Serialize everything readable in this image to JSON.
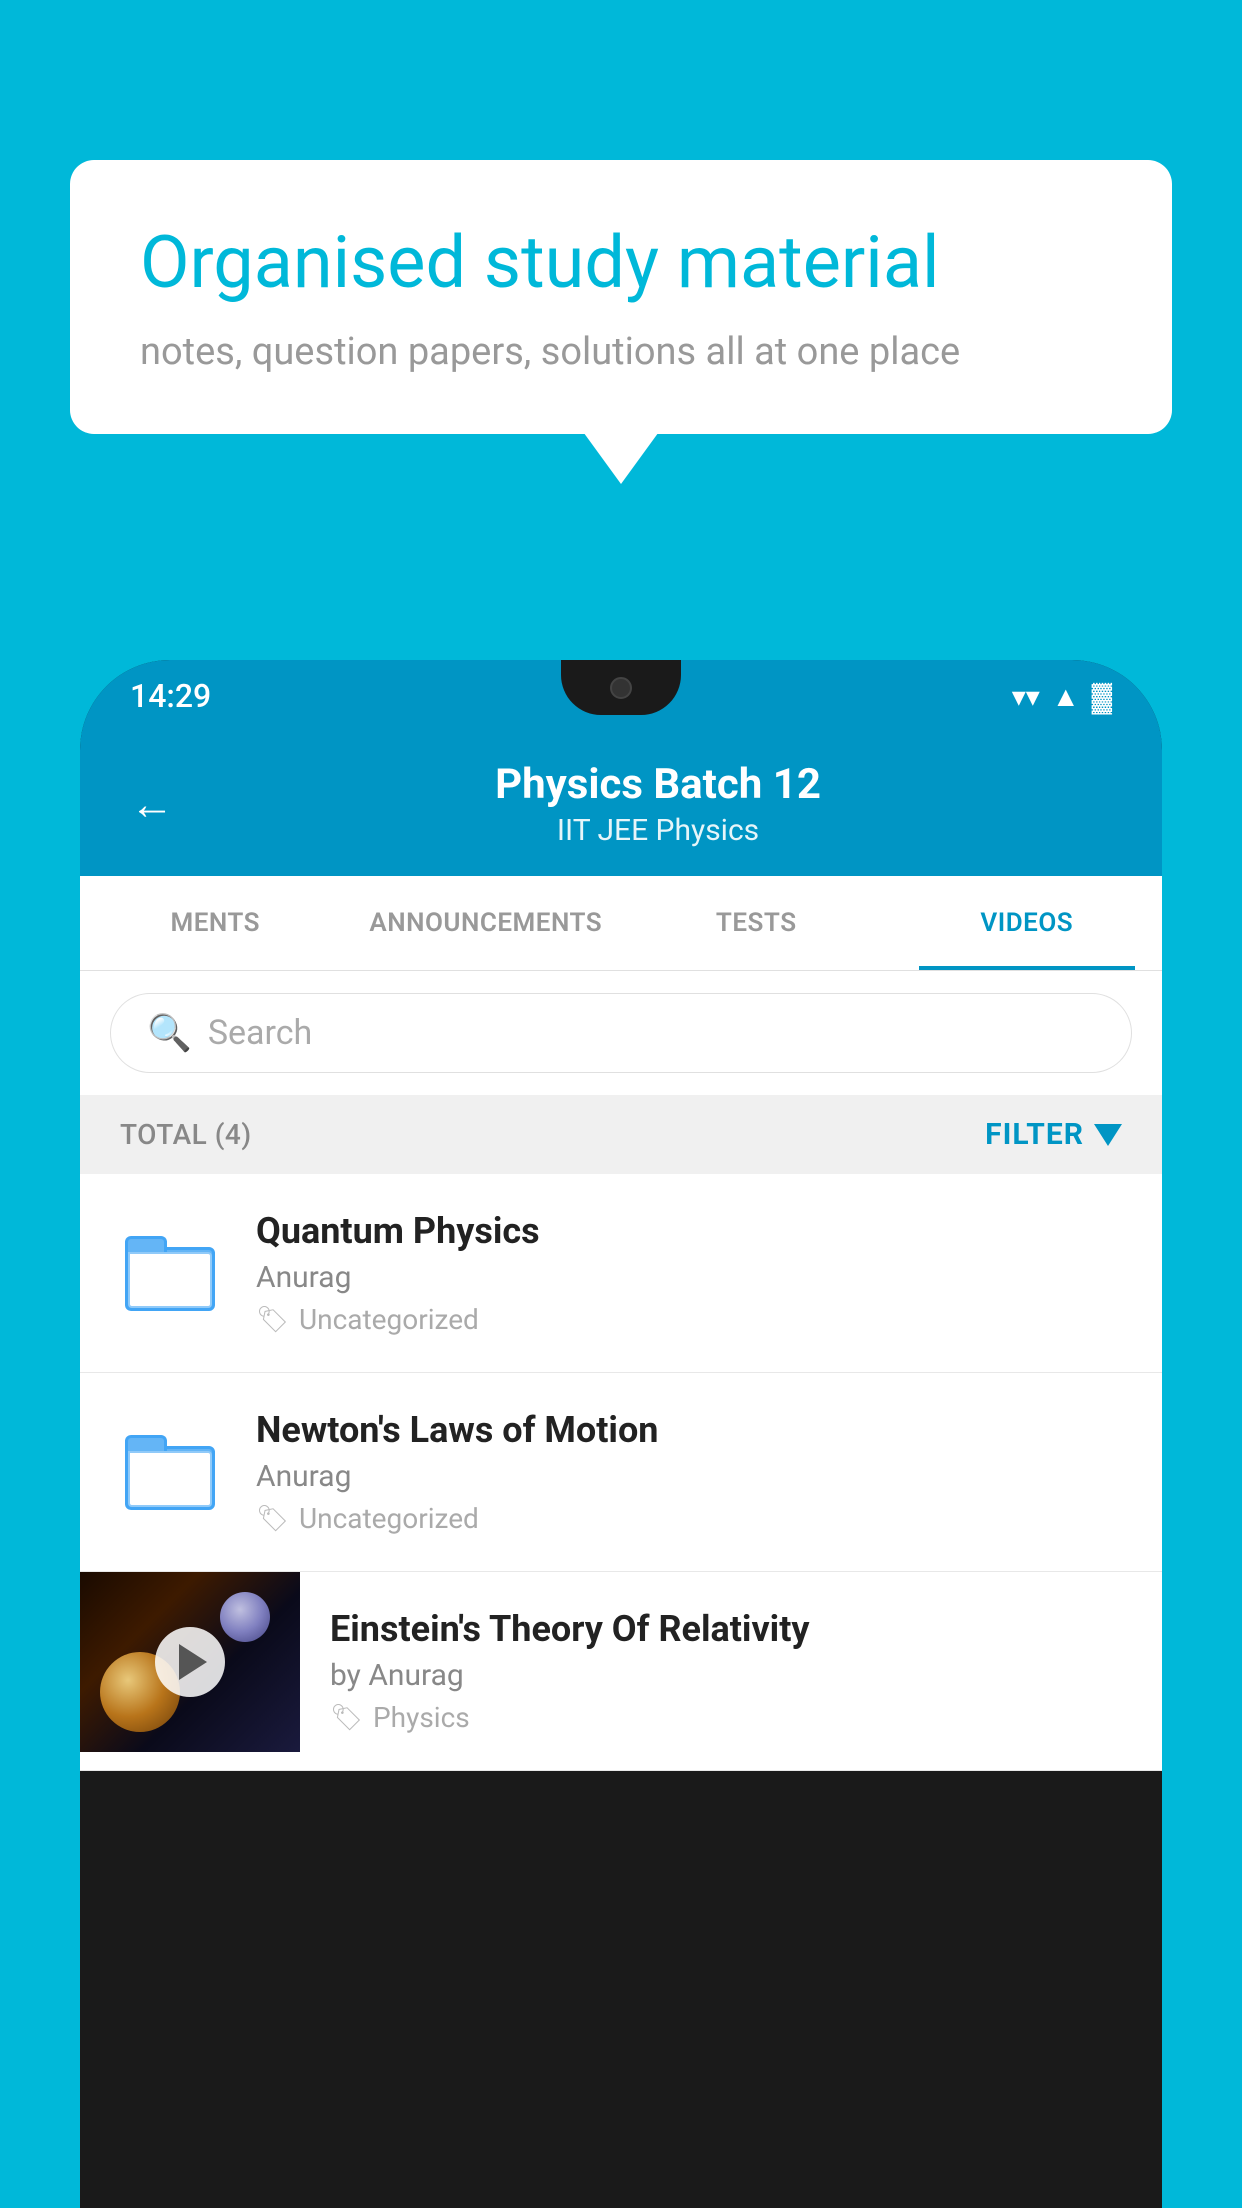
{
  "background_color": "#00B8D9",
  "speech_bubble": {
    "headline": "Organised study material",
    "subtext": "notes, question papers, solutions all at one place"
  },
  "status_bar": {
    "time": "14:29",
    "wifi": "▼",
    "signal": "▲",
    "battery": "▓"
  },
  "app_header": {
    "back_label": "←",
    "title": "Physics Batch 12",
    "subtitle_tags": "IIT JEE   Physics"
  },
  "tabs": [
    {
      "label": "MENTS",
      "active": false
    },
    {
      "label": "ANNOUNCEMENTS",
      "active": false
    },
    {
      "label": "TESTS",
      "active": false
    },
    {
      "label": "VIDEOS",
      "active": true
    }
  ],
  "search": {
    "placeholder": "Search"
  },
  "filter_bar": {
    "total_label": "TOTAL (4)",
    "filter_label": "FILTER"
  },
  "videos": [
    {
      "title": "Quantum Physics",
      "author": "Anurag",
      "tag": "Uncategorized",
      "type": "folder"
    },
    {
      "title": "Newton's Laws of Motion",
      "author": "Anurag",
      "tag": "Uncategorized",
      "type": "folder"
    },
    {
      "title": "Einstein's Theory Of Relativity",
      "author": "by Anurag",
      "tag": "Physics",
      "type": "video"
    }
  ]
}
